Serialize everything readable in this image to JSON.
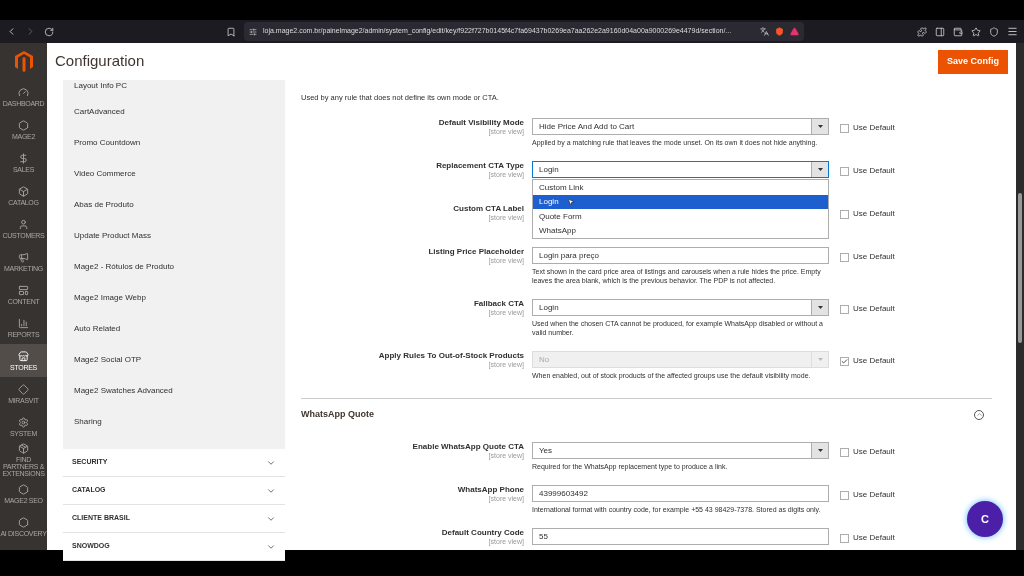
{
  "browser": {
    "url": "loja.mage2.com.br/painelmage2/admin/system_config/edit/key/f922f727b0145f4c7fa69437b0269ea7aa262e2a9160d04a00a9000269e4479d/section/..."
  },
  "admin_menu": [
    {
      "label": "DASHBOARD",
      "selected": false
    },
    {
      "label": "MAGE2",
      "selected": false
    },
    {
      "label": "SALES",
      "selected": false
    },
    {
      "label": "CATALOG",
      "selected": false
    },
    {
      "label": "CUSTOMERS",
      "selected": false
    },
    {
      "label": "MARKETING",
      "selected": false
    },
    {
      "label": "CONTENT",
      "selected": false
    },
    {
      "label": "REPORTS",
      "selected": false
    },
    {
      "label": "STORES",
      "selected": true
    },
    {
      "label": "MIRASVIT",
      "selected": false
    },
    {
      "label": "SYSTEM",
      "selected": false
    },
    {
      "label": "FIND PARTNERS & EXTENSIONS",
      "selected": false
    },
    {
      "label": "MAGE2 SEO",
      "selected": false
    },
    {
      "label": "AI DISCOVERY",
      "selected": false
    }
  ],
  "page_title": "Configuration",
  "save_button": "Save Config",
  "config_tabs": {
    "items": [
      "Layout Info PC",
      "CartAdvanced",
      "Promo Countdown",
      "Video Commerce",
      "Abas de Produto",
      "Update Product Mass",
      "Mage2 - Rótulos de Produto",
      "Mage2 Image Webp",
      "Auto Related",
      "Mage2 Social OTP",
      "Mage2 Swatches Advanced",
      "Sharing"
    ],
    "sections": [
      {
        "label": "SECURITY",
        "expanded": false
      },
      {
        "label": "CATALOG",
        "expanded": false
      },
      {
        "label": "CLIENTE BRASIL",
        "expanded": false
      },
      {
        "label": "SNOWDOG",
        "expanded": false
      }
    ]
  },
  "intro": "Used by any rule that does not define its own mode or CTA.",
  "fields": [
    {
      "label": "Default Visibility Mode",
      "scope": "[store view]",
      "kind": "select",
      "value": "Hide Price And Add to Cart",
      "hint": "Applied by a matching rule that leaves the mode unset. On its own it does not hide anything.",
      "use_default": "Use Default",
      "checked": false,
      "disabled": false
    },
    {
      "label": "Replacement CTA Type",
      "scope": "[store view]",
      "kind": "select",
      "value": "Login",
      "use_default": "Use Default",
      "checked": false,
      "disabled": false,
      "open": true,
      "options": [
        {
          "label": "Custom Link",
          "selected": false
        },
        {
          "label": "Login",
          "selected": true
        },
        {
          "label": "Quote Form",
          "selected": false
        },
        {
          "label": "WhatsApp",
          "selected": false
        }
      ]
    },
    {
      "label": "Custom CTA Label",
      "scope": "[store view]",
      "kind": "text",
      "use_default": "Use Default",
      "checked": false
    },
    {
      "label": "Listing Price Placeholder",
      "scope": "[store view]",
      "kind": "text",
      "value": "Login para preço",
      "hint": "Text shown in the card price area of listings and carousels when a rule hides the price. Empty leaves the area blank, which is the previous behavior. The PDP is not affected.",
      "use_default": "Use Default",
      "checked": false,
      "disabled": false
    },
    {
      "label": "Fallback CTA",
      "scope": "[store view]",
      "kind": "select",
      "value": "Login",
      "hint": "Used when the chosen CTA cannot be produced, for example WhatsApp disabled or without a valid number.",
      "use_default": "Use Default",
      "checked": false,
      "disabled": false
    },
    {
      "label": "Apply Rules To Out-of-Stock Products",
      "scope": "[store view]",
      "kind": "select",
      "value": "No",
      "hint": "When enabled, out of stock products of the affected groups use the default visibility mode.",
      "use_default": "Use Default",
      "checked": true,
      "disabled": true
    }
  ],
  "whatsapp_section": {
    "title": "WhatsApp Quote",
    "expanded": true,
    "fields": [
      {
        "label": "Enable WhatsApp Quote CTA",
        "scope": "[store view]",
        "kind": "select",
        "value": "Yes",
        "hint": "Required for the WhatsApp replacement type to produce a link.",
        "use_default": "Use Default",
        "checked": false,
        "disabled": false
      },
      {
        "label": "WhatsApp Phone",
        "scope": "[store view]",
        "kind": "text",
        "value": "43999603492",
        "hint": "International format with country code, for example +55 43 98429-7378. Stored as digits only.",
        "use_default": "Use Default",
        "checked": false,
        "disabled": false
      },
      {
        "label": "Default Country Code",
        "scope": "[store view]",
        "kind": "text",
        "value": "55",
        "use_default": "Use Default",
        "checked": false,
        "disabled": false
      }
    ]
  },
  "chat_button": "C"
}
